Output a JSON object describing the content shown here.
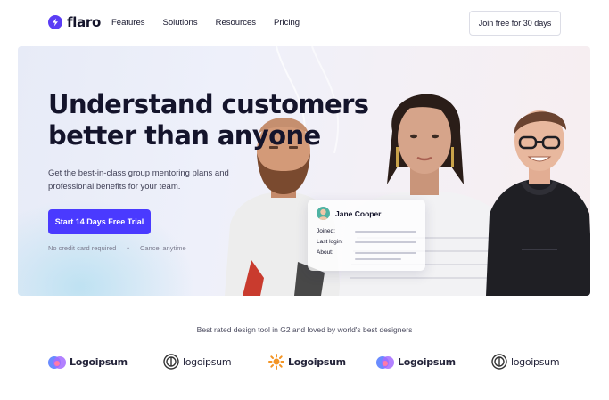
{
  "nav": {
    "brand": "flaro",
    "links": [
      "Features",
      "Solutions",
      "Resources",
      "Pricing"
    ],
    "cta": "Join free for 30 days"
  },
  "hero": {
    "headline_line1": "Understand customers",
    "headline_line2": "better than anyone",
    "subcopy_line1": "Get the best-in-class group mentoring plans and",
    "subcopy_line2": "professional benefits for your team.",
    "primary_button": "Start 14 Days Free Trial",
    "note_1": "No credit card required",
    "note_2": "Cancel anytime"
  },
  "profile_card": {
    "name": "Jane Cooper",
    "rows": [
      "Joined:",
      "Last login:",
      "About:"
    ]
  },
  "social_proof": {
    "tagline": "Best rated design tool in G2 and loved by world's best designers",
    "logos": [
      "Logoipsum",
      "logoipsum",
      "Logoipsum",
      "Logoipsum",
      "logoipsum"
    ]
  },
  "colors": {
    "brand": "#5b3df5",
    "primary_button": "#4a3aff",
    "text": "#14142b"
  }
}
